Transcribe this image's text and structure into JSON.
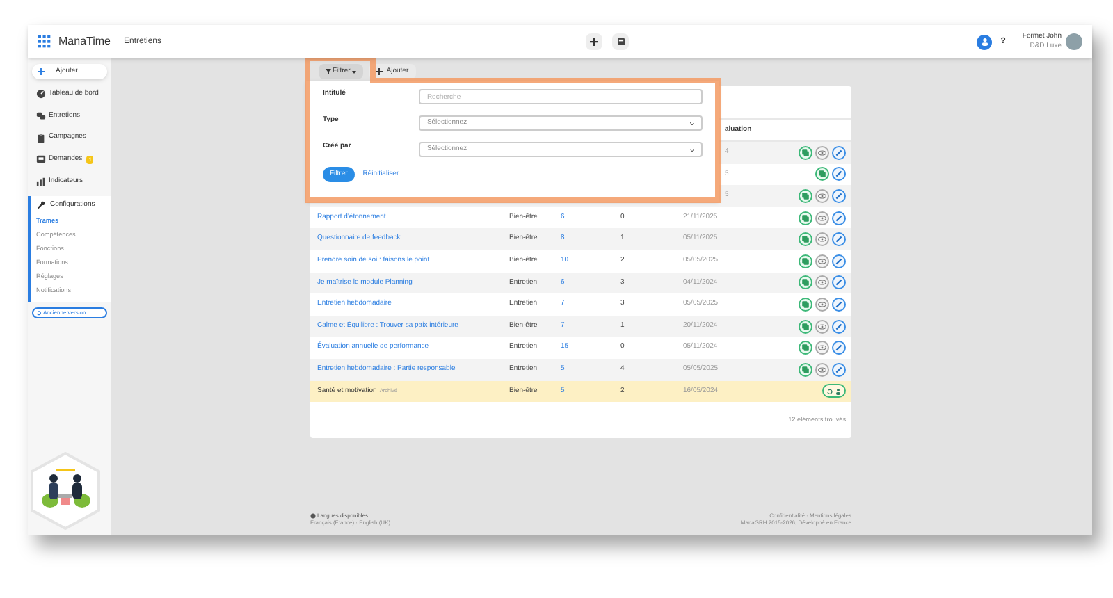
{
  "topbar": {
    "app_name": "ManaTime",
    "section": "Entretiens",
    "help": "?",
    "user_name": "Formet John",
    "user_company": "D&D Luxe"
  },
  "sidebar": {
    "add_button": "Ajouter",
    "items": [
      {
        "label": "Tableau de bord",
        "kind": "dashboard"
      },
      {
        "label": "Entretiens",
        "kind": "chat"
      },
      {
        "label": "Campagnes",
        "kind": "clipboard"
      },
      {
        "label": "Demandes",
        "kind": "inbox",
        "badge": "1"
      },
      {
        "label": "Indicateurs",
        "kind": "chart"
      }
    ],
    "config": {
      "label": "Configurations",
      "items": [
        {
          "label": "Trames",
          "selected": true
        },
        {
          "label": "Compétences",
          "selected": false
        },
        {
          "label": "Fonctions",
          "selected": false
        },
        {
          "label": "Formations",
          "selected": false
        },
        {
          "label": "Réglages",
          "selected": false
        },
        {
          "label": "Notifications",
          "selected": false
        }
      ]
    },
    "old_version_button": "Ancienne version"
  },
  "toolbar": {
    "filter_button": "Filtrer",
    "add_button": "Ajouter"
  },
  "filter_panel": {
    "fields": [
      {
        "label": "Intitulé",
        "kind": "text",
        "placeholder": "Recherche"
      },
      {
        "label": "Type",
        "kind": "select",
        "placeholder": "Sélectionnez"
      },
      {
        "label": "Créé par",
        "kind": "select",
        "placeholder": "Sélectionnez"
      }
    ],
    "apply_button": "Filtrer",
    "reset_link": "Réinitialiser"
  },
  "table": {
    "date_header": "aluation",
    "rows": [
      {
        "date": "4",
        "actions": [
          {
            "kind": "copy"
          },
          {
            "kind": "view"
          },
          {
            "kind": "edit"
          }
        ],
        "archived": false
      },
      {
        "date": "5",
        "actions": [
          {
            "kind": "copy"
          },
          {
            "kind": "edit"
          }
        ],
        "archived": false
      },
      {
        "date": "5",
        "actions": [
          {
            "kind": "copy"
          },
          {
            "kind": "view"
          },
          {
            "kind": "edit"
          }
        ],
        "archived": false
      },
      {
        "name": "Rapport d'étonnement",
        "type": "Bien-être",
        "count": "6",
        "count2": "0",
        "date": "21/11/2025",
        "actions": [
          {
            "kind": "copy"
          },
          {
            "kind": "view"
          },
          {
            "kind": "edit"
          }
        ],
        "archived": false
      },
      {
        "name": "Questionnaire de feedback",
        "type": "Bien-être",
        "count": "8",
        "count2": "1",
        "date": "05/11/2025",
        "actions": [
          {
            "kind": "copy"
          },
          {
            "kind": "view"
          },
          {
            "kind": "edit"
          }
        ],
        "archived": false
      },
      {
        "name": "Prendre soin de soi : faisons le point",
        "type": "Bien-être",
        "count": "10",
        "count2": "2",
        "date": "05/05/2025",
        "actions": [
          {
            "kind": "copy"
          },
          {
            "kind": "view"
          },
          {
            "kind": "edit"
          }
        ],
        "archived": false
      },
      {
        "name": "Je maîtrise le module Planning",
        "type": "Entretien",
        "count": "6",
        "count2": "3",
        "date": "04/11/2024",
        "actions": [
          {
            "kind": "copy"
          },
          {
            "kind": "view"
          },
          {
            "kind": "edit"
          }
        ],
        "archived": false
      },
      {
        "name": "Entretien hebdomadaire",
        "type": "Entretien",
        "count": "7",
        "count2": "3",
        "date": "05/05/2025",
        "actions": [
          {
            "kind": "copy"
          },
          {
            "kind": "view"
          },
          {
            "kind": "edit"
          }
        ],
        "archived": false
      },
      {
        "name": "Calme et Équilibre : Trouver sa paix intérieure",
        "type": "Bien-être",
        "count": "7",
        "count2": "1",
        "date": "20/11/2024",
        "actions": [
          {
            "kind": "copy"
          },
          {
            "kind": "view"
          },
          {
            "kind": "edit"
          }
        ],
        "archived": false
      },
      {
        "name": "Évaluation annuelle de performance",
        "type": "Entretien",
        "count": "15",
        "count2": "0",
        "date": "05/11/2024",
        "actions": [
          {
            "kind": "copy"
          },
          {
            "kind": "view"
          },
          {
            "kind": "edit"
          }
        ],
        "archived": false
      },
      {
        "name": "Entretien hebdomadaire : Partie responsable",
        "type": "Entretien",
        "count": "5",
        "count2": "4",
        "date": "05/05/2025",
        "actions": [
          {
            "kind": "copy"
          },
          {
            "kind": "view"
          },
          {
            "kind": "edit"
          }
        ],
        "archived": false
      },
      {
        "name": "Santé et motivation",
        "tag": "Archivé",
        "type": "Bien-être",
        "count": "5",
        "count2": "2",
        "date": "16/05/2024",
        "actions": [
          {
            "kind": "restore"
          }
        ],
        "archived": true
      }
    ],
    "footer": "12 éléments trouvés"
  },
  "footer": {
    "languages_title": "Langues disponibles",
    "languages": "Français (France) · English (UK)",
    "legal": "Confidentialité · Mentions légales",
    "copyright": "ManaGRH 2015-2026, Développé en France"
  }
}
